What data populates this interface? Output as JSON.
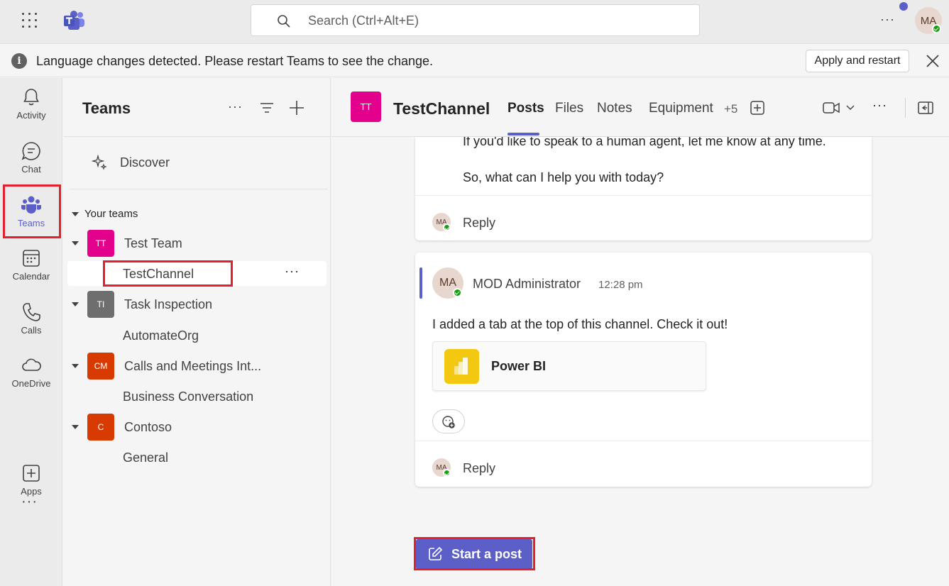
{
  "topbar": {
    "search_placeholder": "Search (Ctrl+Alt+E)",
    "more_label": "···",
    "user_initials": "MA"
  },
  "banner": {
    "message": "Language changes detected. Please restart Teams to see the change.",
    "apply_label": "Apply and restart",
    "info_glyph": "i"
  },
  "rail": {
    "items": [
      {
        "label": "Activity",
        "icon": "bell-icon"
      },
      {
        "label": "Chat",
        "icon": "chat-icon"
      },
      {
        "label": "Teams",
        "icon": "teams-icon",
        "active": true
      },
      {
        "label": "Calendar",
        "icon": "calendar-icon"
      },
      {
        "label": "Calls",
        "icon": "phone-icon"
      },
      {
        "label": "OneDrive",
        "icon": "cloud-icon"
      },
      {
        "label": "Apps",
        "icon": "plus-box-icon"
      }
    ],
    "more_label": "···"
  },
  "teams_pane": {
    "title": "Teams",
    "more_label": "···",
    "discover_label": "Discover",
    "section_label": "Your teams",
    "teams": [
      {
        "initials": "TT",
        "name": "Test Team",
        "color": "#e3008c",
        "channels": [
          "TestChannel"
        ]
      },
      {
        "initials": "TI",
        "name": "Task Inspection",
        "color": "#6e6e6e",
        "channels": [
          "AutomateOrg"
        ]
      },
      {
        "initials": "CM",
        "name": "Calls and Meetings Int...",
        "color": "#d83b01",
        "channels": [
          "Business Conversation"
        ]
      },
      {
        "initials": "C",
        "name": "Contoso",
        "color": "#d83b01",
        "channels": [
          "General"
        ]
      }
    ],
    "selected_channel_more": "···"
  },
  "channel": {
    "avatar_initials": "TT",
    "title": "TestChannel",
    "tabs": [
      "Posts",
      "Files",
      "Notes",
      "Equipment"
    ],
    "active_tab": "Posts",
    "extra_tabs": "+5",
    "more_label": "···"
  },
  "posts": {
    "card1_lines": [
      "If you'd like to speak to a human agent, let me know at any time.",
      "So, what can I help you with today?"
    ],
    "reply_label": "Reply",
    "reply_avatar": "MA",
    "message": {
      "author_initials": "MA",
      "author": "MOD Administrator",
      "time": "12:28 pm",
      "body": "I added a tab at the top of this channel. Check it out!",
      "app_name": "Power BI"
    },
    "start_post_label": "Start a post"
  },
  "colors": {
    "brand": "#5b5fc7",
    "highlight": "#e5202e",
    "presence": "#13a10e"
  }
}
